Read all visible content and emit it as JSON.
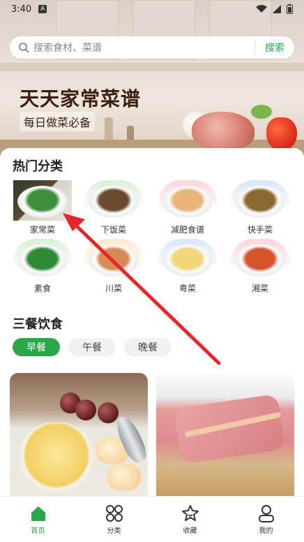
{
  "status_bar": {
    "time": "3:40",
    "a_badge": "A"
  },
  "hero": {
    "title": "天天家常菜谱",
    "subtitle": "每日做菜必备"
  },
  "search": {
    "placeholder": "搜索食材、菜谱",
    "button_label": "搜索"
  },
  "popular": {
    "title": "热门分类",
    "categories": [
      {
        "label": "家常菜",
        "food_color": "#3f8f3a"
      },
      {
        "label": "下饭菜",
        "food_color": "#6a4a2c"
      },
      {
        "label": "减肥食谱",
        "food_color": "#e8b47a"
      },
      {
        "label": "快手菜",
        "food_color": "#8a6a2e"
      },
      {
        "label": "素食",
        "food_color": "#2e8a35"
      },
      {
        "label": "川菜",
        "food_color": "#d98a54"
      },
      {
        "label": "粤菜",
        "food_color": "#f1d67a"
      },
      {
        "label": "湘菜",
        "food_color": "#d6532b"
      }
    ],
    "bg_colors": [
      "#ffffff",
      "#d8f0d6",
      "#fbd6d9",
      "#d8e6f8",
      "#d8f0d6",
      "#fde8cc",
      "#d8e6f8",
      "#fbd6d9"
    ]
  },
  "meals": {
    "title": "三餐饮食",
    "tabs": [
      {
        "label": "早餐",
        "active": true
      },
      {
        "label": "午餐",
        "active": false
      },
      {
        "label": "晚餐",
        "active": false
      }
    ]
  },
  "bottom_nav": [
    {
      "label": "首页",
      "icon": "home-icon",
      "active": true
    },
    {
      "label": "分类",
      "icon": "grid-icon",
      "active": false
    },
    {
      "label": "收藏",
      "icon": "star-icon",
      "active": false
    },
    {
      "label": "我的",
      "icon": "person-icon",
      "active": false
    }
  ],
  "colors": {
    "accent": "#2aa64b",
    "arrow": "#e5262b"
  }
}
